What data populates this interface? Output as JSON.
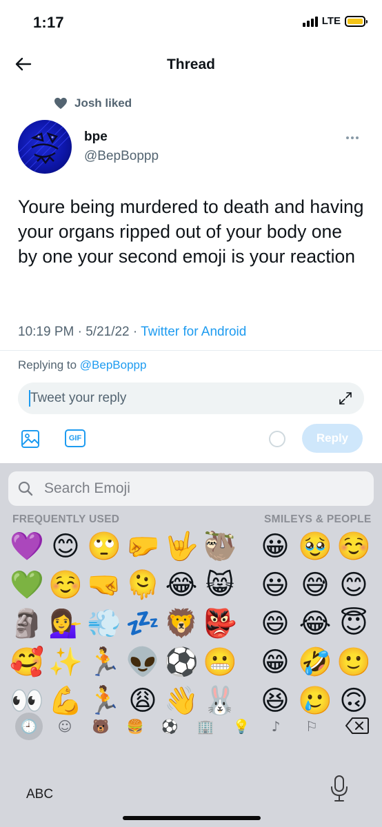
{
  "status_bar": {
    "time": "1:17",
    "network": "LTE",
    "battery_color": "#f5c518"
  },
  "header": {
    "title": "Thread"
  },
  "social_context": {
    "text": "Josh liked"
  },
  "tweet": {
    "author_name": "bpe",
    "author_handle": "@BepBoppp",
    "text": "Youre being murdered to death and having your organs ripped out of your body one by one your second emoji is your reaction",
    "time": "10:19 PM",
    "date": "5/21/22",
    "source": "Twitter for Android"
  },
  "reply": {
    "replying_prefix": "Replying to ",
    "replying_handle": "@BepBoppp",
    "placeholder": "Tweet your reply",
    "gif_label": "GIF",
    "button_label": "Reply"
  },
  "keyboard": {
    "search_placeholder": "Search Emoji",
    "section_frequently": "FREQUENTLY USED",
    "section_smileys": "SMILEYS & PEOPLE",
    "frequently_used": [
      [
        "💜",
        "😊",
        "🙄",
        "🤛",
        "🤟",
        "🦥"
      ],
      [
        "💚",
        "☺️",
        "🤜",
        "🫠",
        "😂",
        "😸"
      ],
      [
        "🗿",
        "💁‍♀️",
        "💨",
        "💤",
        "🦁",
        "👺"
      ],
      [
        "🥰",
        "✨",
        "🏃",
        "👽",
        "⚽",
        "😬"
      ],
      [
        "👀",
        "💪",
        "🏃",
        "😩",
        "👋",
        "🐰"
      ]
    ],
    "smileys_people": [
      [
        "😀",
        "🥹",
        "☺️"
      ],
      [
        "😃",
        "😅",
        "😊"
      ],
      [
        "😄",
        "😂",
        "😇"
      ],
      [
        "😁",
        "🤣",
        "🙂"
      ],
      [
        "😆",
        "🥲",
        "🙃"
      ]
    ],
    "categories": [
      "recent-icon",
      "smiley-icon",
      "animal-icon",
      "food-icon",
      "activity-icon",
      "travel-icon",
      "objects-icon",
      "symbols-icon",
      "flags-icon"
    ],
    "category_glyphs": [
      "🕘",
      "☺",
      "🐻",
      "🍔",
      "⚽",
      "🏢",
      "💡",
      "♪",
      "⚐"
    ],
    "abc_label": "ABC"
  }
}
